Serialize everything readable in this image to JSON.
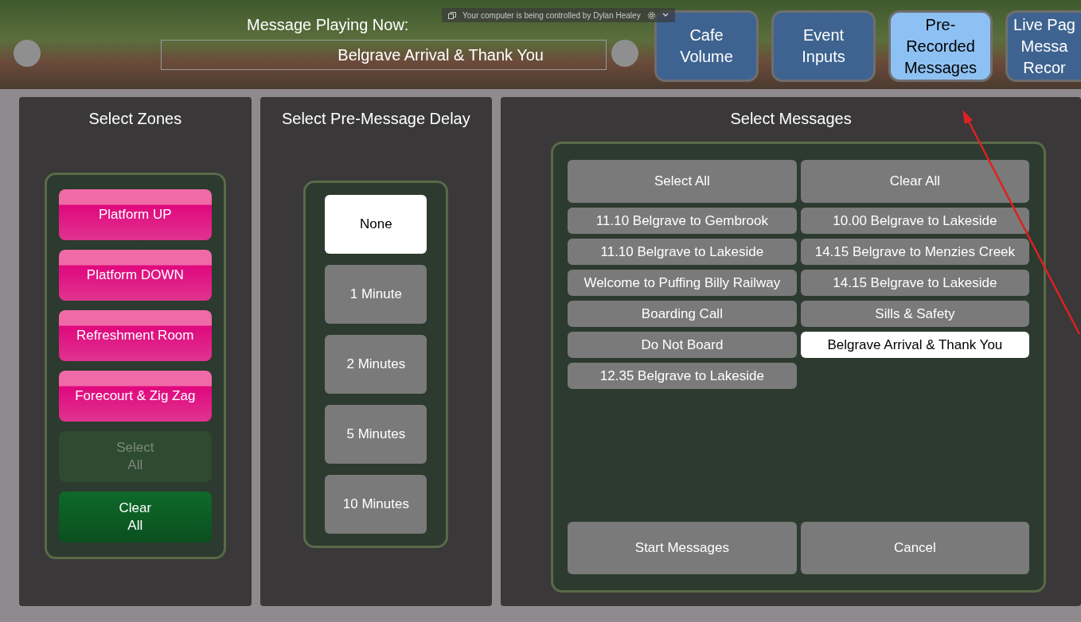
{
  "header": {
    "title": "Message Playing Now:",
    "now_playing": "Belgrave Arrival & Thank You",
    "remote_banner": "Your computer is being controlled by Dylan Healey"
  },
  "tabs": [
    {
      "lines": [
        "Cafe",
        "Volume"
      ],
      "selected": false
    },
    {
      "lines": [
        "Event",
        "Inputs"
      ],
      "selected": false
    },
    {
      "lines": [
        "Pre-",
        "Recorded",
        "Messages"
      ],
      "selected": true
    },
    {
      "lines": [
        "Live Pag",
        "Messa",
        "Recor"
      ],
      "selected": false
    }
  ],
  "zones": {
    "title": "Select Zones",
    "items": [
      {
        "label": "Platform UP",
        "kind": "zone"
      },
      {
        "label": "Platform DOWN",
        "kind": "zone"
      },
      {
        "label": "Refreshment Room",
        "kind": "zone"
      },
      {
        "label": "Forecourt & Zig Zag",
        "kind": "zone"
      },
      {
        "label": "Select\nAll",
        "kind": "action",
        "disabled": true
      },
      {
        "label": "Clear\nAll",
        "kind": "action",
        "disabled": false
      }
    ]
  },
  "delay": {
    "title": "Select Pre-Message Delay",
    "options": [
      {
        "label": "None",
        "selected": true
      },
      {
        "label": "1 Minute",
        "selected": false
      },
      {
        "label": "2 Minutes",
        "selected": false
      },
      {
        "label": "5 Minutes",
        "selected": false
      },
      {
        "label": "10 Minutes",
        "selected": false
      }
    ]
  },
  "messages": {
    "title": "Select Messages",
    "select_all": "Select All",
    "clear_all": "Clear All",
    "items": [
      {
        "label": "11.10 Belgrave to Gembrook",
        "selected": false
      },
      {
        "label": "10.00 Belgrave to Lakeside",
        "selected": false
      },
      {
        "label": "11.10 Belgrave to Lakeside",
        "selected": false
      },
      {
        "label": "14.15 Belgrave to Menzies Creek",
        "selected": false
      },
      {
        "label": "Welcome to Puffing Billy Railway",
        "selected": false
      },
      {
        "label": "14.15 Belgrave to Lakeside",
        "selected": false
      },
      {
        "label": "Boarding Call",
        "selected": false
      },
      {
        "label": "Sills & Safety",
        "selected": false
      },
      {
        "label": "Do Not Board",
        "selected": false
      },
      {
        "label": "Belgrave Arrival & Thank You",
        "selected": true
      },
      {
        "label": "12.35 Belgrave to Lakeside",
        "selected": false
      }
    ],
    "start": "Start Messages",
    "cancel": "Cancel"
  }
}
